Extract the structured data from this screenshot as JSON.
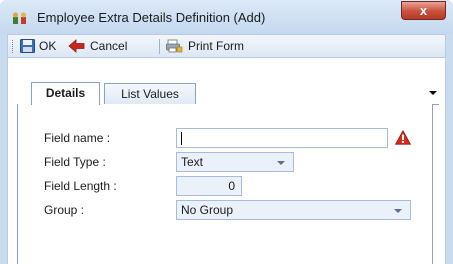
{
  "window": {
    "title": "Employee Extra Details Definition (Add)",
    "close_label": "x"
  },
  "toolbar": {
    "ok_label": "OK",
    "cancel_label": "Cancel",
    "print_label": "Print Form"
  },
  "tabs": [
    {
      "label": "Details",
      "active": true
    },
    {
      "label": "List Values",
      "active": false
    }
  ],
  "form": {
    "field_name": {
      "label": "Field name :",
      "value": ""
    },
    "field_type": {
      "label": "Field Type :",
      "value": "Text"
    },
    "field_length": {
      "label": "Field Length :",
      "value": "0"
    },
    "group": {
      "label": "Group :",
      "value": "No Group"
    }
  },
  "colors": {
    "window_frame": "#c9dbef",
    "close_button": "#c9513d",
    "error_icon": "#d92a1c"
  }
}
